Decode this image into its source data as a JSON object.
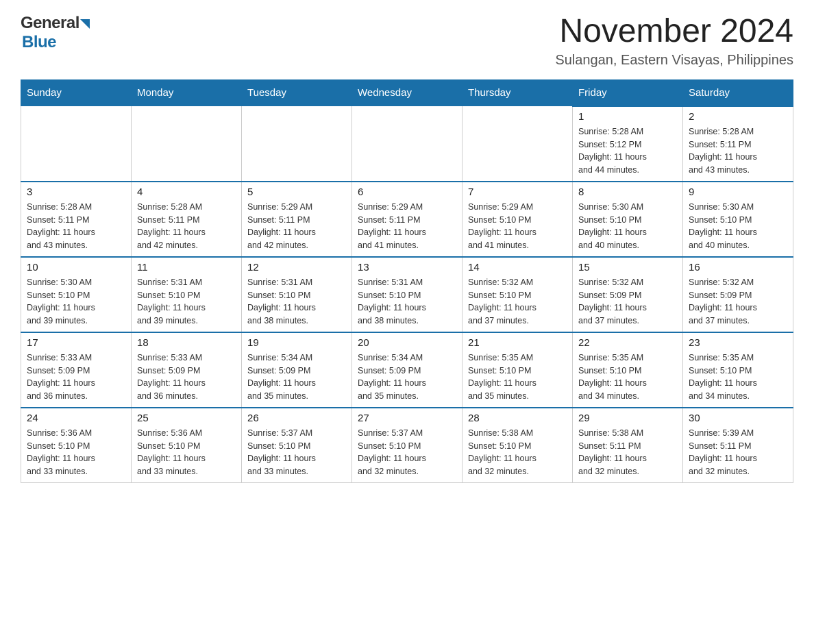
{
  "header": {
    "logo_general": "General",
    "logo_blue": "Blue",
    "title": "November 2024",
    "subtitle": "Sulangan, Eastern Visayas, Philippines"
  },
  "days_of_week": [
    "Sunday",
    "Monday",
    "Tuesday",
    "Wednesday",
    "Thursday",
    "Friday",
    "Saturday"
  ],
  "weeks": [
    [
      {
        "day": "",
        "info": ""
      },
      {
        "day": "",
        "info": ""
      },
      {
        "day": "",
        "info": ""
      },
      {
        "day": "",
        "info": ""
      },
      {
        "day": "",
        "info": ""
      },
      {
        "day": "1",
        "info": "Sunrise: 5:28 AM\nSunset: 5:12 PM\nDaylight: 11 hours\nand 44 minutes."
      },
      {
        "day": "2",
        "info": "Sunrise: 5:28 AM\nSunset: 5:11 PM\nDaylight: 11 hours\nand 43 minutes."
      }
    ],
    [
      {
        "day": "3",
        "info": "Sunrise: 5:28 AM\nSunset: 5:11 PM\nDaylight: 11 hours\nand 43 minutes."
      },
      {
        "day": "4",
        "info": "Sunrise: 5:28 AM\nSunset: 5:11 PM\nDaylight: 11 hours\nand 42 minutes."
      },
      {
        "day": "5",
        "info": "Sunrise: 5:29 AM\nSunset: 5:11 PM\nDaylight: 11 hours\nand 42 minutes."
      },
      {
        "day": "6",
        "info": "Sunrise: 5:29 AM\nSunset: 5:11 PM\nDaylight: 11 hours\nand 41 minutes."
      },
      {
        "day": "7",
        "info": "Sunrise: 5:29 AM\nSunset: 5:10 PM\nDaylight: 11 hours\nand 41 minutes."
      },
      {
        "day": "8",
        "info": "Sunrise: 5:30 AM\nSunset: 5:10 PM\nDaylight: 11 hours\nand 40 minutes."
      },
      {
        "day": "9",
        "info": "Sunrise: 5:30 AM\nSunset: 5:10 PM\nDaylight: 11 hours\nand 40 minutes."
      }
    ],
    [
      {
        "day": "10",
        "info": "Sunrise: 5:30 AM\nSunset: 5:10 PM\nDaylight: 11 hours\nand 39 minutes."
      },
      {
        "day": "11",
        "info": "Sunrise: 5:31 AM\nSunset: 5:10 PM\nDaylight: 11 hours\nand 39 minutes."
      },
      {
        "day": "12",
        "info": "Sunrise: 5:31 AM\nSunset: 5:10 PM\nDaylight: 11 hours\nand 38 minutes."
      },
      {
        "day": "13",
        "info": "Sunrise: 5:31 AM\nSunset: 5:10 PM\nDaylight: 11 hours\nand 38 minutes."
      },
      {
        "day": "14",
        "info": "Sunrise: 5:32 AM\nSunset: 5:10 PM\nDaylight: 11 hours\nand 37 minutes."
      },
      {
        "day": "15",
        "info": "Sunrise: 5:32 AM\nSunset: 5:09 PM\nDaylight: 11 hours\nand 37 minutes."
      },
      {
        "day": "16",
        "info": "Sunrise: 5:32 AM\nSunset: 5:09 PM\nDaylight: 11 hours\nand 37 minutes."
      }
    ],
    [
      {
        "day": "17",
        "info": "Sunrise: 5:33 AM\nSunset: 5:09 PM\nDaylight: 11 hours\nand 36 minutes."
      },
      {
        "day": "18",
        "info": "Sunrise: 5:33 AM\nSunset: 5:09 PM\nDaylight: 11 hours\nand 36 minutes."
      },
      {
        "day": "19",
        "info": "Sunrise: 5:34 AM\nSunset: 5:09 PM\nDaylight: 11 hours\nand 35 minutes."
      },
      {
        "day": "20",
        "info": "Sunrise: 5:34 AM\nSunset: 5:09 PM\nDaylight: 11 hours\nand 35 minutes."
      },
      {
        "day": "21",
        "info": "Sunrise: 5:35 AM\nSunset: 5:10 PM\nDaylight: 11 hours\nand 35 minutes."
      },
      {
        "day": "22",
        "info": "Sunrise: 5:35 AM\nSunset: 5:10 PM\nDaylight: 11 hours\nand 34 minutes."
      },
      {
        "day": "23",
        "info": "Sunrise: 5:35 AM\nSunset: 5:10 PM\nDaylight: 11 hours\nand 34 minutes."
      }
    ],
    [
      {
        "day": "24",
        "info": "Sunrise: 5:36 AM\nSunset: 5:10 PM\nDaylight: 11 hours\nand 33 minutes."
      },
      {
        "day": "25",
        "info": "Sunrise: 5:36 AM\nSunset: 5:10 PM\nDaylight: 11 hours\nand 33 minutes."
      },
      {
        "day": "26",
        "info": "Sunrise: 5:37 AM\nSunset: 5:10 PM\nDaylight: 11 hours\nand 33 minutes."
      },
      {
        "day": "27",
        "info": "Sunrise: 5:37 AM\nSunset: 5:10 PM\nDaylight: 11 hours\nand 32 minutes."
      },
      {
        "day": "28",
        "info": "Sunrise: 5:38 AM\nSunset: 5:10 PM\nDaylight: 11 hours\nand 32 minutes."
      },
      {
        "day": "29",
        "info": "Sunrise: 5:38 AM\nSunset: 5:11 PM\nDaylight: 11 hours\nand 32 minutes."
      },
      {
        "day": "30",
        "info": "Sunrise: 5:39 AM\nSunset: 5:11 PM\nDaylight: 11 hours\nand 32 minutes."
      }
    ]
  ],
  "colors": {
    "header_bg": "#1a6fa8",
    "header_text": "#ffffff",
    "border": "#aaaaaa",
    "row_top_border": "#1a6fa8"
  }
}
